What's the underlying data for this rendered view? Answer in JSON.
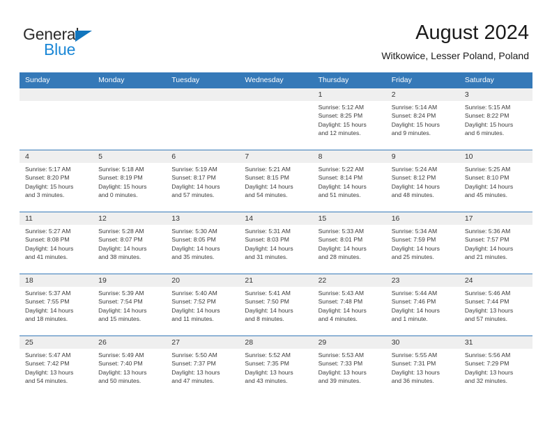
{
  "brand": {
    "name_part1": "General",
    "name_part2": "Blue",
    "icon": "triangle-logo",
    "colors": {
      "accent": "#1175bd",
      "blue_text": "#1a87d6"
    }
  },
  "header": {
    "title": "August 2024",
    "subtitle": "Witkowice, Lesser Poland, Poland"
  },
  "theme": {
    "header_row_bg": "#3579b8",
    "daynum_bg": "#efefef",
    "grid_line": "#3579b8",
    "text": "#3a3a3a"
  },
  "weekday_headers": [
    "Sunday",
    "Monday",
    "Tuesday",
    "Wednesday",
    "Thursday",
    "Friday",
    "Saturday"
  ],
  "weeks": [
    [
      {
        "day": "",
        "empty": true,
        "sunrise": "",
        "sunset": "",
        "daylight1": "",
        "daylight2": ""
      },
      {
        "day": "",
        "empty": true,
        "sunrise": "",
        "sunset": "",
        "daylight1": "",
        "daylight2": ""
      },
      {
        "day": "",
        "empty": true,
        "sunrise": "",
        "sunset": "",
        "daylight1": "",
        "daylight2": ""
      },
      {
        "day": "",
        "empty": true,
        "sunrise": "",
        "sunset": "",
        "daylight1": "",
        "daylight2": ""
      },
      {
        "day": "1",
        "sunrise": "Sunrise: 5:12 AM",
        "sunset": "Sunset: 8:25 PM",
        "daylight1": "Daylight: 15 hours",
        "daylight2": "and 12 minutes."
      },
      {
        "day": "2",
        "sunrise": "Sunrise: 5:14 AM",
        "sunset": "Sunset: 8:24 PM",
        "daylight1": "Daylight: 15 hours",
        "daylight2": "and 9 minutes."
      },
      {
        "day": "3",
        "sunrise": "Sunrise: 5:15 AM",
        "sunset": "Sunset: 8:22 PM",
        "daylight1": "Daylight: 15 hours",
        "daylight2": "and 6 minutes."
      }
    ],
    [
      {
        "day": "4",
        "sunrise": "Sunrise: 5:17 AM",
        "sunset": "Sunset: 8:20 PM",
        "daylight1": "Daylight: 15 hours",
        "daylight2": "and 3 minutes."
      },
      {
        "day": "5",
        "sunrise": "Sunrise: 5:18 AM",
        "sunset": "Sunset: 8:19 PM",
        "daylight1": "Daylight: 15 hours",
        "daylight2": "and 0 minutes."
      },
      {
        "day": "6",
        "sunrise": "Sunrise: 5:19 AM",
        "sunset": "Sunset: 8:17 PM",
        "daylight1": "Daylight: 14 hours",
        "daylight2": "and 57 minutes."
      },
      {
        "day": "7",
        "sunrise": "Sunrise: 5:21 AM",
        "sunset": "Sunset: 8:15 PM",
        "daylight1": "Daylight: 14 hours",
        "daylight2": "and 54 minutes."
      },
      {
        "day": "8",
        "sunrise": "Sunrise: 5:22 AM",
        "sunset": "Sunset: 8:14 PM",
        "daylight1": "Daylight: 14 hours",
        "daylight2": "and 51 minutes."
      },
      {
        "day": "9",
        "sunrise": "Sunrise: 5:24 AM",
        "sunset": "Sunset: 8:12 PM",
        "daylight1": "Daylight: 14 hours",
        "daylight2": "and 48 minutes."
      },
      {
        "day": "10",
        "sunrise": "Sunrise: 5:25 AM",
        "sunset": "Sunset: 8:10 PM",
        "daylight1": "Daylight: 14 hours",
        "daylight2": "and 45 minutes."
      }
    ],
    [
      {
        "day": "11",
        "sunrise": "Sunrise: 5:27 AM",
        "sunset": "Sunset: 8:08 PM",
        "daylight1": "Daylight: 14 hours",
        "daylight2": "and 41 minutes."
      },
      {
        "day": "12",
        "sunrise": "Sunrise: 5:28 AM",
        "sunset": "Sunset: 8:07 PM",
        "daylight1": "Daylight: 14 hours",
        "daylight2": "and 38 minutes."
      },
      {
        "day": "13",
        "sunrise": "Sunrise: 5:30 AM",
        "sunset": "Sunset: 8:05 PM",
        "daylight1": "Daylight: 14 hours",
        "daylight2": "and 35 minutes."
      },
      {
        "day": "14",
        "sunrise": "Sunrise: 5:31 AM",
        "sunset": "Sunset: 8:03 PM",
        "daylight1": "Daylight: 14 hours",
        "daylight2": "and 31 minutes."
      },
      {
        "day": "15",
        "sunrise": "Sunrise: 5:33 AM",
        "sunset": "Sunset: 8:01 PM",
        "daylight1": "Daylight: 14 hours",
        "daylight2": "and 28 minutes."
      },
      {
        "day": "16",
        "sunrise": "Sunrise: 5:34 AM",
        "sunset": "Sunset: 7:59 PM",
        "daylight1": "Daylight: 14 hours",
        "daylight2": "and 25 minutes."
      },
      {
        "day": "17",
        "sunrise": "Sunrise: 5:36 AM",
        "sunset": "Sunset: 7:57 PM",
        "daylight1": "Daylight: 14 hours",
        "daylight2": "and 21 minutes."
      }
    ],
    [
      {
        "day": "18",
        "sunrise": "Sunrise: 5:37 AM",
        "sunset": "Sunset: 7:55 PM",
        "daylight1": "Daylight: 14 hours",
        "daylight2": "and 18 minutes."
      },
      {
        "day": "19",
        "sunrise": "Sunrise: 5:39 AM",
        "sunset": "Sunset: 7:54 PM",
        "daylight1": "Daylight: 14 hours",
        "daylight2": "and 15 minutes."
      },
      {
        "day": "20",
        "sunrise": "Sunrise: 5:40 AM",
        "sunset": "Sunset: 7:52 PM",
        "daylight1": "Daylight: 14 hours",
        "daylight2": "and 11 minutes."
      },
      {
        "day": "21",
        "sunrise": "Sunrise: 5:41 AM",
        "sunset": "Sunset: 7:50 PM",
        "daylight1": "Daylight: 14 hours",
        "daylight2": "and 8 minutes."
      },
      {
        "day": "22",
        "sunrise": "Sunrise: 5:43 AM",
        "sunset": "Sunset: 7:48 PM",
        "daylight1": "Daylight: 14 hours",
        "daylight2": "and 4 minutes."
      },
      {
        "day": "23",
        "sunrise": "Sunrise: 5:44 AM",
        "sunset": "Sunset: 7:46 PM",
        "daylight1": "Daylight: 14 hours",
        "daylight2": "and 1 minute."
      },
      {
        "day": "24",
        "sunrise": "Sunrise: 5:46 AM",
        "sunset": "Sunset: 7:44 PM",
        "daylight1": "Daylight: 13 hours",
        "daylight2": "and 57 minutes."
      }
    ],
    [
      {
        "day": "25",
        "sunrise": "Sunrise: 5:47 AM",
        "sunset": "Sunset: 7:42 PM",
        "daylight1": "Daylight: 13 hours",
        "daylight2": "and 54 minutes."
      },
      {
        "day": "26",
        "sunrise": "Sunrise: 5:49 AM",
        "sunset": "Sunset: 7:40 PM",
        "daylight1": "Daylight: 13 hours",
        "daylight2": "and 50 minutes."
      },
      {
        "day": "27",
        "sunrise": "Sunrise: 5:50 AM",
        "sunset": "Sunset: 7:37 PM",
        "daylight1": "Daylight: 13 hours",
        "daylight2": "and 47 minutes."
      },
      {
        "day": "28",
        "sunrise": "Sunrise: 5:52 AM",
        "sunset": "Sunset: 7:35 PM",
        "daylight1": "Daylight: 13 hours",
        "daylight2": "and 43 minutes."
      },
      {
        "day": "29",
        "sunrise": "Sunrise: 5:53 AM",
        "sunset": "Sunset: 7:33 PM",
        "daylight1": "Daylight: 13 hours",
        "daylight2": "and 39 minutes."
      },
      {
        "day": "30",
        "sunrise": "Sunrise: 5:55 AM",
        "sunset": "Sunset: 7:31 PM",
        "daylight1": "Daylight: 13 hours",
        "daylight2": "and 36 minutes."
      },
      {
        "day": "31",
        "sunrise": "Sunrise: 5:56 AM",
        "sunset": "Sunset: 7:29 PM",
        "daylight1": "Daylight: 13 hours",
        "daylight2": "and 32 minutes."
      }
    ]
  ]
}
